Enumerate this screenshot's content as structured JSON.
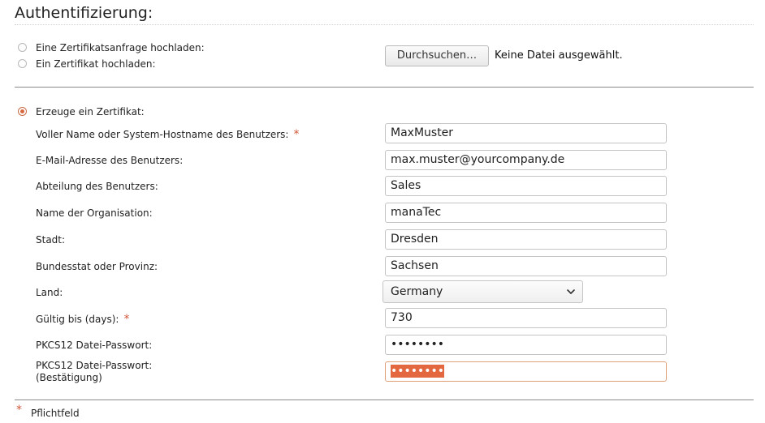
{
  "section_title": "Authentifizierung:",
  "upload": {
    "option_request": "Eine Zertifikatsanfrage hochladen:",
    "option_certificate": "Ein Zertifikat hochladen:",
    "browse_label": "Durchsuchen…",
    "no_file_text": "Keine Datei ausgewählt."
  },
  "generate": {
    "option_label": "Erzeuge ein Zertifikat:",
    "required_mark": "*",
    "fields": {
      "name_label": "Voller Name oder System-Hostname des Benutzers:",
      "name_value": "MaxMuster",
      "email_label": "E-Mail-Adresse des Benutzers:",
      "email_value": "max.muster@yourcompany.de",
      "department_label": "Abteilung des Benutzers:",
      "department_value": "Sales",
      "org_label": "Name der Organisation:",
      "org_value": "manaTec",
      "city_label": "Stadt:",
      "city_value": "Dresden",
      "state_label": "Bundesstat oder Provinz:",
      "state_value": "Sachsen",
      "country_label": "Land:",
      "country_value": "Germany",
      "valid_label": "Gültig bis (days):",
      "valid_value": "730",
      "pkcs_label": "PKCS12 Datei-Passwort:",
      "pkcs_value": "••••••••",
      "pkcs_confirm_label": "PKCS12 Datei-Passwort:",
      "pkcs_confirm_label_2": "(Bestätigung)",
      "pkcs_confirm_value": "••••••••"
    }
  },
  "footer": {
    "required_mark": "*",
    "required_text": "Pflichtfeld"
  },
  "colors": {
    "accent": "#d9683e",
    "required": "#d0593a",
    "selection": "#e4683f"
  },
  "icons": {
    "select_arrow": "chevron-down-icon"
  }
}
